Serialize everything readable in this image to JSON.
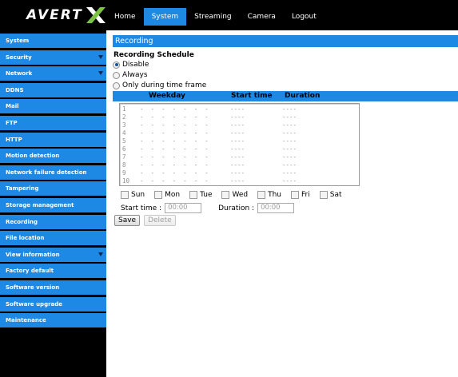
{
  "header": {
    "logo_text": "AVERT",
    "nav": [
      {
        "label": "Home",
        "active": false
      },
      {
        "label": "System",
        "active": true
      },
      {
        "label": "Streaming",
        "active": false
      },
      {
        "label": "Camera",
        "active": false
      },
      {
        "label": "Logout",
        "active": false
      }
    ]
  },
  "sidebar": {
    "items": [
      {
        "label": "System",
        "has_arrow": false
      },
      {
        "label": "Security",
        "has_arrow": true
      },
      {
        "label": "Network",
        "has_arrow": true
      },
      {
        "label": "DDNS",
        "has_arrow": false
      },
      {
        "label": "Mail",
        "has_arrow": false
      },
      {
        "label": "FTP",
        "has_arrow": false
      },
      {
        "label": "HTTP",
        "has_arrow": false
      },
      {
        "label": "Motion detection",
        "has_arrow": false
      },
      {
        "label": "Network failure detection",
        "has_arrow": false
      },
      {
        "label": "Tampering",
        "has_arrow": false
      },
      {
        "label": "Storage management",
        "has_arrow": false
      },
      {
        "label": "Recording",
        "has_arrow": false
      },
      {
        "label": "File location",
        "has_arrow": false
      },
      {
        "label": "View information",
        "has_arrow": true
      },
      {
        "label": "Factory default",
        "has_arrow": false
      },
      {
        "label": "Software version",
        "has_arrow": false
      },
      {
        "label": "Software upgrade",
        "has_arrow": false
      },
      {
        "label": "Maintenance",
        "has_arrow": false
      }
    ]
  },
  "main": {
    "section_title": "Recording",
    "schedule_title": "Recording Schedule",
    "options": [
      {
        "label": "Disable",
        "checked": true
      },
      {
        "label": "Always",
        "checked": false
      },
      {
        "label": "Only during time frame",
        "checked": false
      }
    ],
    "table_headers": {
      "weekday": "Weekday",
      "start_time": "Start time",
      "duration": "Duration"
    },
    "rows": [
      {
        "index": "1",
        "days": "-  -  -  -  -  -  -",
        "start": "----",
        "duration": "----"
      },
      {
        "index": "2",
        "days": "-  -  -  -  -  -  -",
        "start": "----",
        "duration": "----"
      },
      {
        "index": "3",
        "days": "-  -  -  -  -  -  -",
        "start": "----",
        "duration": "----"
      },
      {
        "index": "4",
        "days": "-  -  -  -  -  -  -",
        "start": "----",
        "duration": "----"
      },
      {
        "index": "5",
        "days": "-  -  -  -  -  -  -",
        "start": "----",
        "duration": "----"
      },
      {
        "index": "6",
        "days": "-  -  -  -  -  -  -",
        "start": "----",
        "duration": "----"
      },
      {
        "index": "7",
        "days": "-  -  -  -  -  -  -",
        "start": "----",
        "duration": "----"
      },
      {
        "index": "8",
        "days": "-  -  -  -  -  -  -",
        "start": "----",
        "duration": "----"
      },
      {
        "index": "9",
        "days": "-  -  -  -  -  -  -",
        "start": "----",
        "duration": "----"
      },
      {
        "index": "10",
        "days": "-  -  -  -  -  -  -",
        "start": "----",
        "duration": "----"
      }
    ],
    "days": [
      "Sun",
      "Mon",
      "Tue",
      "Wed",
      "Thu",
      "Fri",
      "Sat"
    ],
    "start_time_label": "Start time :",
    "start_time_value": "00:00",
    "duration_label": "Duration :",
    "duration_value": "00:00",
    "save_label": "Save",
    "delete_label": "Delete"
  },
  "colors": {
    "accent": "#1e88e5",
    "background_dark": "#000000"
  }
}
